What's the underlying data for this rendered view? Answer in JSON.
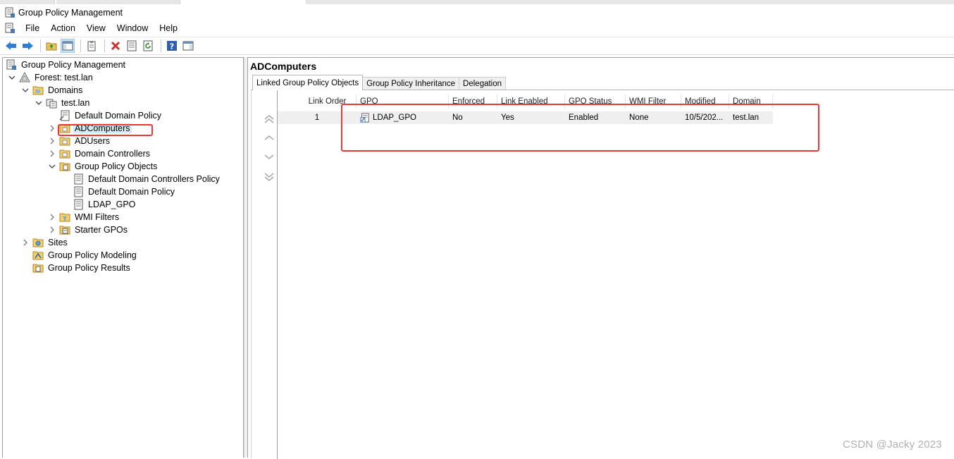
{
  "window": {
    "title": "Group Policy Management"
  },
  "menu": [
    "File",
    "Action",
    "View",
    "Window",
    "Help"
  ],
  "toolbar": [
    {
      "name": "back-icon"
    },
    {
      "name": "forward-icon"
    },
    {
      "name": "up-folder-icon"
    },
    {
      "name": "show-hide-console-tree-icon",
      "pressed": true
    },
    {
      "name": "clipboard-icon"
    },
    {
      "name": "delete-icon"
    },
    {
      "name": "properties-icon"
    },
    {
      "name": "refresh-icon"
    },
    {
      "name": "help-icon"
    },
    {
      "name": "show-action-pane-icon"
    }
  ],
  "tree": {
    "items": [
      {
        "label": "Group Policy Management",
        "level": 0,
        "toggle": "",
        "icon": "gpm-root-icon"
      },
      {
        "label": "Forest: test.lan",
        "level": 1,
        "toggle": "expanded",
        "icon": "forest-icon"
      },
      {
        "label": "Domains",
        "level": 2,
        "toggle": "expanded",
        "icon": "folder-icon"
      },
      {
        "label": "test.lan",
        "level": 3,
        "toggle": "expanded",
        "icon": "domain-icon"
      },
      {
        "label": "Default Domain Policy",
        "level": 4,
        "toggle": "",
        "icon": "gpo-link-icon"
      },
      {
        "label": "ADComputers",
        "level": 4,
        "toggle": "collapsed",
        "icon": "ou-folder-icon",
        "selected": true
      },
      {
        "label": "ADUsers",
        "level": 4,
        "toggle": "collapsed",
        "icon": "ou-folder-icon"
      },
      {
        "label": "Domain Controllers",
        "level": 4,
        "toggle": "collapsed",
        "icon": "ou-folder-icon"
      },
      {
        "label": "Group Policy Objects",
        "level": 4,
        "toggle": "expanded",
        "icon": "gpo-folder-icon"
      },
      {
        "label": "Default Domain Controllers Policy",
        "level": 5,
        "toggle": "",
        "icon": "gpo-icon"
      },
      {
        "label": "Default Domain Policy",
        "level": 5,
        "toggle": "",
        "icon": "gpo-icon"
      },
      {
        "label": "LDAP_GPO",
        "level": 5,
        "toggle": "",
        "icon": "gpo-icon"
      },
      {
        "label": "WMI Filters",
        "level": 4,
        "toggle": "collapsed",
        "icon": "wmi-folder-icon"
      },
      {
        "label": "Starter GPOs",
        "level": 4,
        "toggle": "collapsed",
        "icon": "starter-folder-icon"
      },
      {
        "label": "Sites",
        "level": 2,
        "toggle": "collapsed",
        "icon": "sites-folder-icon"
      },
      {
        "label": "Group Policy Modeling",
        "level": 2,
        "toggle": "",
        "icon": "modeling-icon"
      },
      {
        "label": "Group Policy Results",
        "level": 2,
        "toggle": "",
        "icon": "results-icon"
      }
    ]
  },
  "main": {
    "title": "ADComputers",
    "tabs": [
      {
        "label": "Linked Group Policy Objects",
        "active": true
      },
      {
        "label": "Group Policy Inheritance",
        "active": false
      },
      {
        "label": "Delegation",
        "active": false
      }
    ],
    "columns": [
      "Link Order",
      "GPO",
      "Enforced",
      "Link Enabled",
      "GPO Status",
      "WMI Filter",
      "Modified",
      "Domain"
    ],
    "rows": [
      [
        "1",
        "LDAP_GPO",
        "No",
        "Yes",
        "Enabled",
        "None",
        "10/5/202...",
        "test.lan"
      ]
    ],
    "order_buttons": [
      "move-to-top-icon",
      "move-up-icon",
      "move-down-icon",
      "move-to-bottom-icon"
    ]
  },
  "watermark": "CSDN @Jacky 2023",
  "colors": {
    "highlight_box": "#e53935",
    "selection": "#d9e8f7",
    "row_bg": "#efefef"
  }
}
